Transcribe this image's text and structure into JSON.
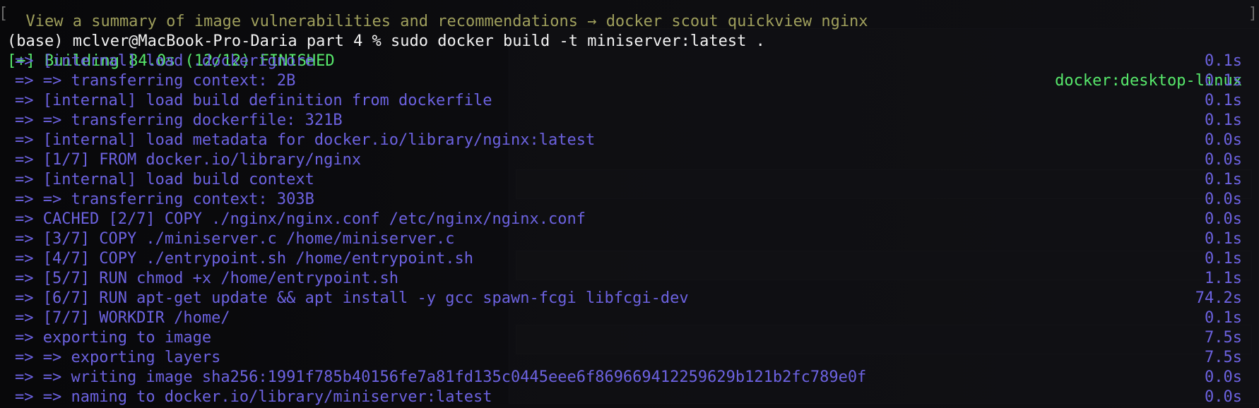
{
  "terminal": {
    "cut_line": "  View a summary of image vulnerabilities and recommendations → docker scout quickview nginx",
    "prompt": "(base) mclver@MacBook-Pro-Daria part 4 % sudo docker build -t miniserver:latest .",
    "header": {
      "text": "[+] Building 84.0s (12/12) FINISHED",
      "context": "docker:desktop-linux"
    },
    "steps": [
      {
        "text": "=> [internal] load .dockerignore",
        "time": "0.1s"
      },
      {
        "text": "=> => transferring context: 2B",
        "time": "0.1s"
      },
      {
        "text": "=> [internal] load build definition from dockerfile",
        "time": "0.1s"
      },
      {
        "text": "=> => transferring dockerfile: 321B",
        "time": "0.1s"
      },
      {
        "text": "=> [internal] load metadata for docker.io/library/nginx:latest",
        "time": "0.0s"
      },
      {
        "text": "=> [1/7] FROM docker.io/library/nginx",
        "time": "0.0s"
      },
      {
        "text": "=> [internal] load build context",
        "time": "0.1s"
      },
      {
        "text": "=> => transferring context: 303B",
        "time": "0.0s"
      },
      {
        "text": "=> CACHED [2/7] COPY ./nginx/nginx.conf /etc/nginx/nginx.conf",
        "time": "0.0s"
      },
      {
        "text": "=> [3/7] COPY ./miniserver.c /home/miniserver.c",
        "time": "0.1s"
      },
      {
        "text": "=> [4/7] COPY ./entrypoint.sh /home/entrypoint.sh",
        "time": "0.1s"
      },
      {
        "text": "=> [5/7] RUN chmod +x /home/entrypoint.sh",
        "time": "1.1s"
      },
      {
        "text": "=> [6/7] RUN apt-get update && apt install -y gcc spawn-fcgi libfcgi-dev",
        "time": "74.2s"
      },
      {
        "text": "=> [7/7] WORKDIR /home/",
        "time": "0.1s"
      },
      {
        "text": "=> exporting to image",
        "time": "7.5s"
      },
      {
        "text": "=> => exporting layers",
        "time": "7.5s"
      },
      {
        "text": "=> => writing image sha256:1991f785b40156fe7a81fd135c0445eee6f869669412259629b121b2fc789e0f",
        "time": "0.0s"
      },
      {
        "text": "=> => naming to docker.io/library/miniserver:latest",
        "time": "0.0s"
      }
    ]
  }
}
